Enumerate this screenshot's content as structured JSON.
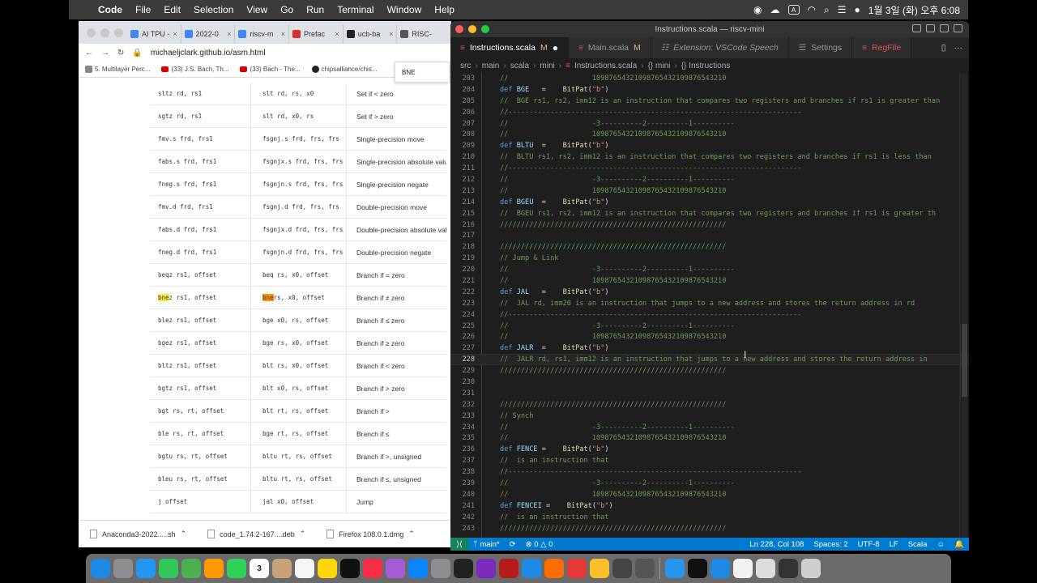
{
  "menubar": {
    "app": "Code",
    "items": [
      "File",
      "Edit",
      "Selection",
      "View",
      "Go",
      "Run",
      "Terminal",
      "Window",
      "Help"
    ],
    "input_indicator": "A",
    "clock": "1월 3일 (화) 오후 6:08"
  },
  "browser": {
    "tabs": [
      {
        "label": "AI TPU -",
        "color": "#4285f4"
      },
      {
        "label": "2022-0",
        "color": "#4285f4"
      },
      {
        "label": "riscv-m",
        "color": "#4285f4"
      },
      {
        "label": "Prefac",
        "color": "#d93025"
      },
      {
        "label": "ucb-ba",
        "color": "#222222"
      },
      {
        "label": "RISC-",
        "color": "#555555"
      }
    ],
    "url": "michaeljclark.github.io/asm.html",
    "bookmarks": [
      "5. Multilayer Perc...",
      "(33) J.S. Bach, Th...",
      "(33) Bach - The...",
      "chipsalliance/chis..."
    ],
    "find_popup": "BNE",
    "rows": [
      {
        "c1": "sltz rd, rs1",
        "c2": "slt rd, rs, x0",
        "c3": "Set if < zero"
      },
      {
        "c1": "sgtz rd, rs1",
        "c2": "slt rd, x0, rs",
        "c3": "Set if > zero"
      },
      {
        "c1": "fmv.s frd, frs1",
        "c2": "fsgnj.s frd, frs, frs",
        "c3": "Single-precision move"
      },
      {
        "c1": "fabs.s frd, frs1",
        "c2": "fsgnjx.s frd, frs, frs",
        "c3": "Single-precision absolute value"
      },
      {
        "c1": "fneg.s frd, frs1",
        "c2": "fsgnjn.s frd, frs, frs",
        "c3": "Single-precision negate"
      },
      {
        "c1": "fmv.d frd, frs1",
        "c2": "fsgnj.d frd, frs, frs",
        "c3": "Double-precision move"
      },
      {
        "c1": "fabs.d frd, frs1",
        "c2": "fsgnjx.d frd, frs, frs",
        "c3": "Double-precision absolute value"
      },
      {
        "c1": "fneg.d frd, frs1",
        "c2": "fsgnjn.d frd, frs, frs",
        "c3": "Double-precision negate"
      },
      {
        "c1": "beqz rs1, offset",
        "c2": "beq rs, x0, offset",
        "c3": "Branch if = zero"
      },
      {
        "c1_hl": "bne",
        "c1": "z rs1, offset",
        "c2_hl": "bne",
        "c2": " rs, x0, offset",
        "c3": "Branch if ≠ zero"
      },
      {
        "c1": "blez rs1, offset",
        "c2": "bge x0, rs, offset",
        "c3": "Branch if ≤ zero"
      },
      {
        "c1": "bgez rs1, offset",
        "c2": "bge rs, x0, offset",
        "c3": "Branch if ≥ zero"
      },
      {
        "c1": "bltz rs1, offset",
        "c2": "blt rs, x0, offset",
        "c3": "Branch if < zero"
      },
      {
        "c1": "bgtz rs1, offset",
        "c2": "blt x0, rs, offset",
        "c3": "Branch if > zero"
      },
      {
        "c1": "bgt rs, rt, offset",
        "c2": "blt rt, rs, offset",
        "c3": "Branch if >"
      },
      {
        "c1": "ble rs, rt, offset",
        "c2": "bge rt, rs, offset",
        "c3": "Branch if ≤"
      },
      {
        "c1": "bgtu rs, rt, offset",
        "c2": "bltu rt, rs, offset",
        "c3": "Branch if >, unsigned"
      },
      {
        "c1": "bleu rs, rt, offset",
        "c2": "bltu rt, rs, offset",
        "c3": "Branch if ≤, unsigned"
      },
      {
        "c1": "j offset",
        "c2": "jal x0, offset",
        "c3": "Jump"
      }
    ],
    "downloads": [
      "Anaconda3-2022.....sh",
      "code_1.74.2-167....deb",
      "Firefox 108.0.1.dmg"
    ]
  },
  "vscode": {
    "title": "Instructions.scala — riscv-mini",
    "tabs": [
      {
        "label": "Instructions.scala",
        "badge": "M",
        "active": true,
        "dirty": true
      },
      {
        "label": "Main.scala",
        "badge": "M",
        "active": false
      },
      {
        "label": "Extension: VSCode Speech",
        "active": false,
        "italic": true
      },
      {
        "label": "Settings",
        "active": false
      },
      {
        "label": "RegFile",
        "active": false
      }
    ],
    "breadcrumb": [
      "src",
      "main",
      "scala",
      "mini",
      "Instructions.scala",
      "{} mini",
      "{} Instructions"
    ],
    "current_line": 228,
    "lines": [
      {
        "n": 203,
        "t": "c",
        "text": "//                    10987654321098765432109876543210"
      },
      {
        "n": 204,
        "t": "d",
        "name": "BGE  ",
        "pat": "\"b\""
      },
      {
        "n": 205,
        "t": "c",
        "text": "//  BGE rs1, rs2, imm12 is an instruction that compares two registers and branches if rs1 is greater than"
      },
      {
        "n": 206,
        "t": "c",
        "text": "//----------------------------------------------------------------------"
      },
      {
        "n": 207,
        "t": "c",
        "text": "//                    -3----------2----------1----------"
      },
      {
        "n": 208,
        "t": "c",
        "text": "//                    10987654321098765432109876543210"
      },
      {
        "n": 209,
        "t": "d",
        "name": "BLTU ",
        "pat": "\"b\""
      },
      {
        "n": 210,
        "t": "c",
        "text": "//  BLTU rs1, rs2, imm12 is an instruction that compares two registers and branches if rs1 is less than"
      },
      {
        "n": 211,
        "t": "c",
        "text": "//----------------------------------------------------------------------"
      },
      {
        "n": 212,
        "t": "c",
        "text": "//                    -3----------2----------1----------"
      },
      {
        "n": 213,
        "t": "c",
        "text": "//                    10987654321098765432109876543210"
      },
      {
        "n": 214,
        "t": "d",
        "name": "BGEU ",
        "pat": "\"b\""
      },
      {
        "n": 215,
        "t": "c",
        "text": "//  BGEU rs1, rs2, imm12 is an instruction that compares two registers and branches if rs1 is greater th"
      },
      {
        "n": 216,
        "t": "c",
        "text": "//////////////////////////////////////////////////////"
      },
      {
        "n": 217,
        "t": "e",
        "text": ""
      },
      {
        "n": 218,
        "t": "c",
        "text": "//////////////////////////////////////////////////////"
      },
      {
        "n": 219,
        "t": "c",
        "text": "// Jump & Link"
      },
      {
        "n": 220,
        "t": "c",
        "text": "//                    -3----------2----------1----------"
      },
      {
        "n": 221,
        "t": "c",
        "text": "//                    10987654321098765432109876543210"
      },
      {
        "n": 222,
        "t": "d",
        "name": "JAL  ",
        "pat": "\"b\""
      },
      {
        "n": 223,
        "t": "c",
        "text": "//  JAL rd, imm20 is an instruction that jumps to a new address and stores the return address in rd"
      },
      {
        "n": 224,
        "t": "c",
        "text": "//----------------------------------------------------------------------"
      },
      {
        "n": 225,
        "t": "c",
        "text": "//                    -3----------2----------1----------"
      },
      {
        "n": 226,
        "t": "c",
        "text": "//                    10987654321098765432109876543210"
      },
      {
        "n": 227,
        "t": "d",
        "name": "JALR ",
        "pat": "\"b\""
      },
      {
        "n": 228,
        "t": "c",
        "text": "//  JALR rd, rs1, imm12 is an instruction that jumps to a new address and stores the return address in"
      },
      {
        "n": 229,
        "t": "c",
        "text": "//////////////////////////////////////////////////////"
      },
      {
        "n": 230,
        "t": "e",
        "text": ""
      },
      {
        "n": 231,
        "t": "e",
        "text": ""
      },
      {
        "n": 232,
        "t": "c",
        "text": "//////////////////////////////////////////////////////"
      },
      {
        "n": 233,
        "t": "c",
        "text": "// Synch"
      },
      {
        "n": 234,
        "t": "c",
        "text": "//                    -3----------2----------1----------"
      },
      {
        "n": 235,
        "t": "c",
        "text": "//                    10987654321098765432109876543210"
      },
      {
        "n": 236,
        "t": "d",
        "name": "FENCE",
        "pat": "\"b\""
      },
      {
        "n": 237,
        "t": "c",
        "text": "//  is an instruction that"
      },
      {
        "n": 238,
        "t": "c",
        "text": "//----------------------------------------------------------------------"
      },
      {
        "n": 239,
        "t": "c",
        "text": "//                    -3----------2----------1----------"
      },
      {
        "n": 240,
        "t": "c",
        "text": "//                    10987654321098765432109876543210"
      },
      {
        "n": 241,
        "t": "d",
        "name": "FENCEI",
        "pat": "\"b\""
      },
      {
        "n": 242,
        "t": "c",
        "text": "//  is an instruction that"
      },
      {
        "n": 243,
        "t": "c",
        "text": "//////////////////////////////////////////////////////"
      }
    ],
    "status": {
      "branch": "main*",
      "errors": "0",
      "warnings": "0",
      "position": "Ln 228, Col 108",
      "spaces": "Spaces: 2",
      "encoding": "UTF-8",
      "eol": "LF",
      "language": "Scala"
    }
  },
  "dock": {
    "apps": [
      {
        "name": "finder-icon",
        "color": "#1e88e5"
      },
      {
        "name": "launchpad-icon",
        "color": "#8e8e93"
      },
      {
        "name": "safari-icon",
        "color": "#2196f3"
      },
      {
        "name": "messages-icon",
        "color": "#34c759"
      },
      {
        "name": "maps-icon",
        "color": "#4caf50"
      },
      {
        "name": "photos-icon",
        "color": "#ff9800"
      },
      {
        "name": "facetime-icon",
        "color": "#30d158"
      },
      {
        "name": "calendar-icon",
        "color": "#ffffff",
        "label": "3"
      },
      {
        "name": "contacts-icon",
        "color": "#c8a27a"
      },
      {
        "name": "reminders-icon",
        "color": "#f5f5f5"
      },
      {
        "name": "notes-icon",
        "color": "#ffd60a"
      },
      {
        "name": "tv-icon",
        "color": "#111111"
      },
      {
        "name": "music-icon",
        "color": "#fa2d48"
      },
      {
        "name": "podcasts-icon",
        "color": "#a35bd6"
      },
      {
        "name": "appstore-icon",
        "color": "#0a84ff"
      },
      {
        "name": "settings-icon",
        "color": "#8e8e93"
      },
      {
        "name": "terminal-icon",
        "color": "#222222"
      },
      {
        "name": "intellij-icon",
        "color": "#7b2cbf"
      },
      {
        "name": "filezilla-icon",
        "color": "#b71c1c"
      },
      {
        "name": "vscode-icon",
        "color": "#1e88e5"
      },
      {
        "name": "firefox-icon",
        "color": "#ff6d00"
      },
      {
        "name": "chrome-icon",
        "color": "#e53935"
      },
      {
        "name": "star-icon",
        "color": "#fbc02d"
      },
      {
        "name": "github-icon",
        "color": "#444444"
      },
      {
        "name": "xcode-icon",
        "color": "#555555"
      },
      {
        "name": "docker-icon",
        "color": "#2496ed"
      },
      {
        "name": "terminal2-icon",
        "color": "#111111"
      },
      {
        "name": "vscode2-icon",
        "color": "#1e88e5"
      },
      {
        "name": "document-icon",
        "color": "#f2f2f2"
      },
      {
        "name": "screenshot-icon",
        "color": "#dddddd"
      },
      {
        "name": "window-icon",
        "color": "#333333"
      },
      {
        "name": "trash-icon",
        "color": "#cfcfcf"
      }
    ]
  }
}
